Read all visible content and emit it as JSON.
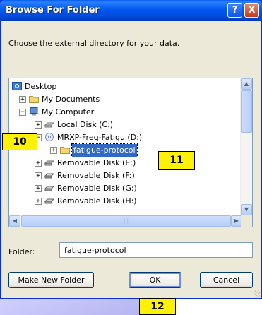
{
  "dialog": {
    "title": "Browse For Folder",
    "help_glyph": "?",
    "close_glyph": "X",
    "instruction": "Choose the external directory for your data."
  },
  "tree": {
    "items": [
      {
        "label": "Desktop",
        "icon": "desktop-icon",
        "expander": ""
      },
      {
        "label": "My Documents",
        "icon": "folder-icon",
        "expander": "+"
      },
      {
        "label": "My Computer",
        "icon": "computer-icon",
        "expander": "−"
      },
      {
        "label": "Local Disk (C:)",
        "icon": "drive-icon",
        "expander": "+"
      },
      {
        "label": "MRXP-Freq-Fatigu (D:)",
        "icon": "cd-drive-icon",
        "expander": "−"
      },
      {
        "label": "fatigue-protocol",
        "icon": "folder-icon",
        "expander": "+",
        "selected": true
      },
      {
        "label": "Removable Disk (E:)",
        "icon": "drive-icon",
        "expander": "+"
      },
      {
        "label": "Removable Disk (F:)",
        "icon": "drive-icon",
        "expander": "+"
      },
      {
        "label": "Removable Disk (G:)",
        "icon": "drive-icon",
        "expander": "+"
      },
      {
        "label": "Removable Disk (H:)",
        "icon": "drive-icon",
        "expander": "+"
      }
    ]
  },
  "folder": {
    "label": "Folder:",
    "value": "fatigue-protocol"
  },
  "buttons": {
    "make_new_folder": "Make New Folder",
    "ok": "OK",
    "cancel": "Cancel"
  },
  "callouts": {
    "a": "10",
    "b": "11",
    "c": "12"
  },
  "colors": {
    "titlebar": "#0058ee",
    "selection": "#316ac5",
    "callout": "#fff200"
  }
}
